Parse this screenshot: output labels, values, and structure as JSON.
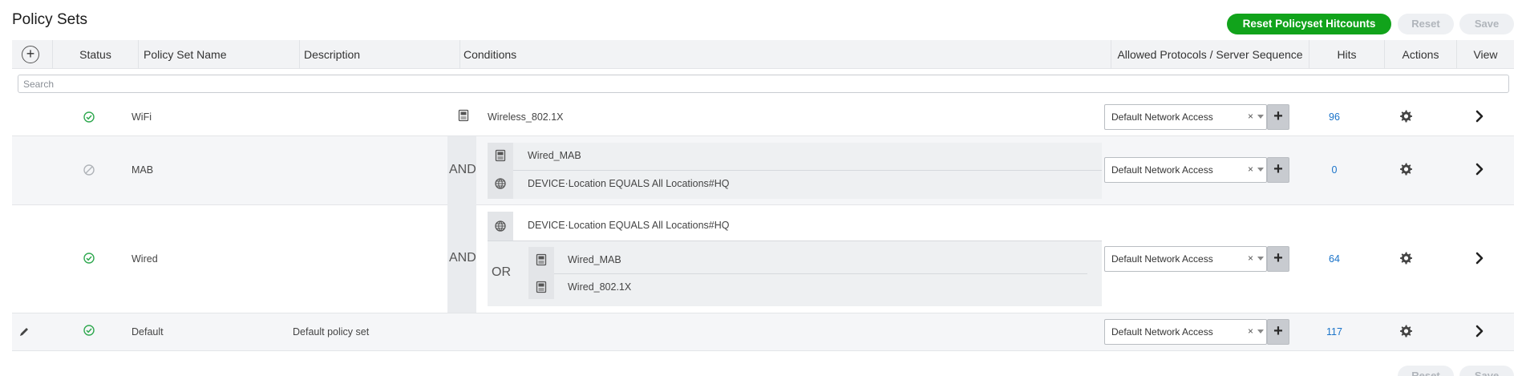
{
  "page": {
    "title": "Policy Sets"
  },
  "toolbar": {
    "reset_hitcounts_label": "Reset Policyset Hitcounts",
    "reset_label": "Reset",
    "save_label": "Save"
  },
  "table": {
    "headers": {
      "status": "Status",
      "name": "Policy Set Name",
      "description": "Description",
      "conditions": "Conditions",
      "protocols": "Allowed Protocols / Server Sequence",
      "hits": "Hits",
      "actions": "Actions",
      "view": "View"
    },
    "search_placeholder": "Search",
    "rows": [
      {
        "name": "WiFi",
        "description": "",
        "status": "enabled",
        "conditions": {
          "single": "Wireless_802.1X"
        },
        "protocol": "Default Network Access",
        "hits": "96"
      },
      {
        "name": "MAB",
        "description": "",
        "status": "disabled",
        "conditions": {
          "operator": "AND",
          "items": [
            "Wired_MAB",
            "DEVICE·Location  EQUALS  All Locations#HQ"
          ]
        },
        "protocol": "Default Network Access",
        "hits": "0"
      },
      {
        "name": "Wired",
        "description": "",
        "status": "enabled",
        "conditions": {
          "operator": "AND",
          "item": "DEVICE·Location  EQUALS  All Locations#HQ",
          "nested_operator": "OR",
          "nested_items": [
            "Wired_MAB",
            "Wired_802.1X"
          ]
        },
        "protocol": "Default Network Access",
        "hits": "64"
      },
      {
        "name": "Default",
        "description": "Default policy set",
        "status": "enabled",
        "conditions": {},
        "protocol": "Default Network Access",
        "hits": "117"
      }
    ]
  },
  "dropdown": {
    "clear_glyph": "×"
  },
  "colors": {
    "accent_green": "#11a31b",
    "link_blue": "#1a73c9",
    "status_green": "#2fa84f",
    "status_grey": "#b0b4b9"
  },
  "icons": {
    "add": "plus-circle-icon",
    "enabled": "check-circle-icon",
    "disabled": "blocked-circle-icon",
    "library_condition": "library-condition-icon",
    "attribute_condition": "globe-icon",
    "actions": "gear-icon",
    "view": "chevron-right-icon",
    "edit": "pencil-icon"
  }
}
